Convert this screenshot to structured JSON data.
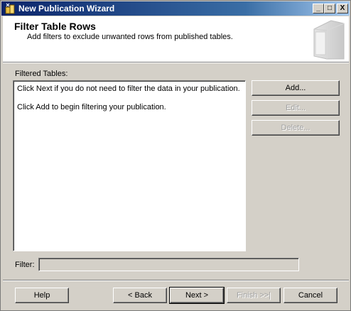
{
  "window": {
    "title": "New Publication Wizard",
    "controls": {
      "minimize": "_",
      "maximize": "□",
      "close": "X"
    }
  },
  "header": {
    "title": "Filter Table Rows",
    "subtitle": "Add filters to exclude unwanted rows from published tables.",
    "graphic": "wizard-book-icon"
  },
  "filtered_tables": {
    "label": "Filtered Tables:",
    "messages": [
      "Click Next if you do not need to filter the data in your publication.",
      "Click Add to begin filtering your publication."
    ]
  },
  "side_buttons": {
    "add": "Add...",
    "edit": "Edit...",
    "delete": "Delete..."
  },
  "filter": {
    "label": "Filter:",
    "value": ""
  },
  "footer": {
    "help": "Help",
    "back": "< Back",
    "next": "Next >",
    "finish": "Finish >>|",
    "cancel": "Cancel"
  }
}
